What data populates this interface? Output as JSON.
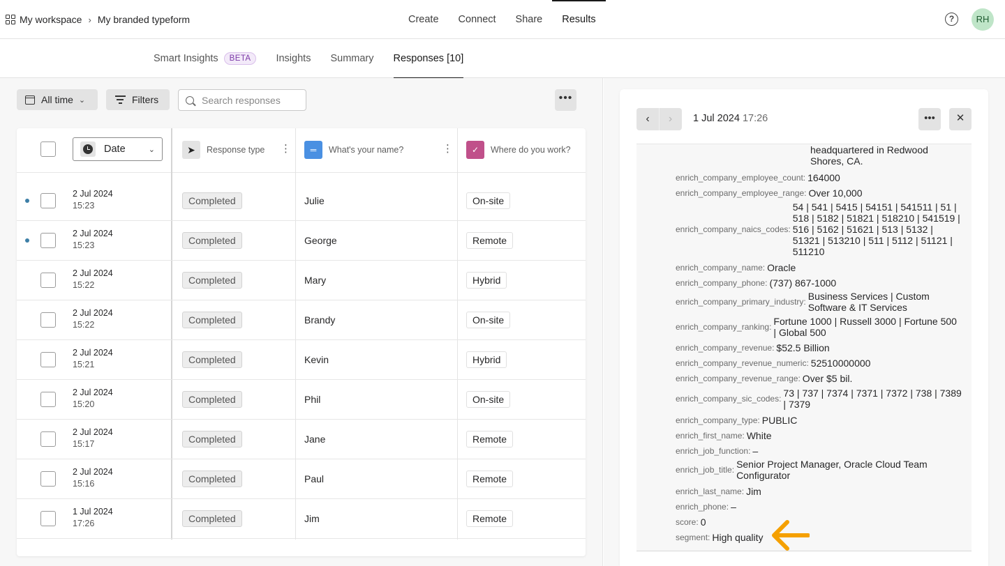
{
  "breadcrumb": {
    "workspace": "My workspace",
    "separator": "›",
    "form": "My branded typeform"
  },
  "topnav": [
    "Create",
    "Connect",
    "Share",
    "Results"
  ],
  "topnav_active": "Results",
  "user": {
    "initials": "RH",
    "avatar_color": "#bfe5c8",
    "help_icon": "?"
  },
  "subtabs": [
    {
      "label": "Smart Insights",
      "badge": "BETA"
    },
    {
      "label": "Insights"
    },
    {
      "label": "Summary"
    },
    {
      "label": "Responses [10]"
    }
  ],
  "toolbar": {
    "time_filter": "All time",
    "filters": "Filters",
    "search_placeholder": "Search responses",
    "more": "•••"
  },
  "table": {
    "sort_label": "Date",
    "headers": {
      "response_type": "Response type",
      "name_question": "What's your name?",
      "work_question": "Where do you work?"
    },
    "rows": [
      {
        "unread": true,
        "date": "2 Jul 2024",
        "time": "15:23",
        "type": "Completed",
        "name": "Julie",
        "work": "On-site"
      },
      {
        "unread": true,
        "date": "2 Jul 2024",
        "time": "15:23",
        "type": "Completed",
        "name": "George",
        "work": "Remote"
      },
      {
        "unread": false,
        "date": "2 Jul 2024",
        "time": "15:22",
        "type": "Completed",
        "name": "Mary",
        "work": "Hybrid"
      },
      {
        "unread": false,
        "date": "2 Jul 2024",
        "time": "15:22",
        "type": "Completed",
        "name": "Brandy",
        "work": "On-site"
      },
      {
        "unread": false,
        "date": "2 Jul 2024",
        "time": "15:21",
        "type": "Completed",
        "name": "Kevin",
        "work": "Hybrid"
      },
      {
        "unread": false,
        "date": "2 Jul 2024",
        "time": "15:20",
        "type": "Completed",
        "name": "Phil",
        "work": "On-site"
      },
      {
        "unread": false,
        "date": "2 Jul 2024",
        "time": "15:17",
        "type": "Completed",
        "name": "Jane",
        "work": "Remote"
      },
      {
        "unread": false,
        "date": "2 Jul 2024",
        "time": "15:16",
        "type": "Completed",
        "name": "Paul",
        "work": "Remote"
      },
      {
        "unread": false,
        "date": "1 Jul 2024",
        "time": "17:26",
        "type": "Completed",
        "name": "Jim",
        "work": "Remote"
      }
    ]
  },
  "detail": {
    "date": "1 Jul 2024",
    "time": "17:26",
    "more": "•••",
    "close": "✕",
    "fields": [
      {
        "key": "",
        "value": "headquartered in Redwood Shores, CA."
      },
      {
        "key": "enrich_company_employee_count:",
        "value": "164000"
      },
      {
        "key": "enrich_company_employee_range:",
        "value": "Over 10,000"
      },
      {
        "key": "enrich_company_naics_codes:",
        "value": "54 | 541 | 5415 | 54151 | 541511 | 51 | 518 | 5182 | 51821 | 518210 | 541519 | 516 | 5162 | 51621 | 513 | 5132 | 51321 | 513210 | 511 | 5112 | 51121 | 511210"
      },
      {
        "key": "enrich_company_name:",
        "value": "Oracle"
      },
      {
        "key": "enrich_company_phone:",
        "value": "(737) 867-1000"
      },
      {
        "key": "enrich_company_primary_industry:",
        "value": "Business Services | Custom Software & IT Services"
      },
      {
        "key": "enrich_company_ranking:",
        "value": "Fortune 1000 | Russell 3000 | Fortune 500 | Global 500"
      },
      {
        "key": "enrich_company_revenue:",
        "value": "$52.5 Billion"
      },
      {
        "key": "enrich_company_revenue_numeric:",
        "value": "52510000000"
      },
      {
        "key": "enrich_company_revenue_range:",
        "value": "Over $5 bil."
      },
      {
        "key": "enrich_company_sic_codes:",
        "value": "73 | 737 | 7374 | 7371 | 7372 | 738 | 7389 | 7379"
      },
      {
        "key": "enrich_company_type:",
        "value": "PUBLIC"
      },
      {
        "key": "enrich_first_name:",
        "value": "White"
      },
      {
        "key": "enrich_job_function:",
        "value": "–"
      },
      {
        "key": "enrich_job_title:",
        "value": "Senior Project Manager, Oracle Cloud Team Configurator"
      },
      {
        "key": "enrich_last_name:",
        "value": "Jim"
      },
      {
        "key": "enrich_phone:",
        "value": "–"
      },
      {
        "key": "score:",
        "value": "0"
      },
      {
        "key": "segment:",
        "value": "High quality"
      }
    ]
  },
  "colors": {
    "accent": "#191919",
    "unread_dot": "#3d7fa7",
    "name_icon": "#4a90e2",
    "work_icon": "#c0508a",
    "annotation_arrow": "#f5a000"
  }
}
